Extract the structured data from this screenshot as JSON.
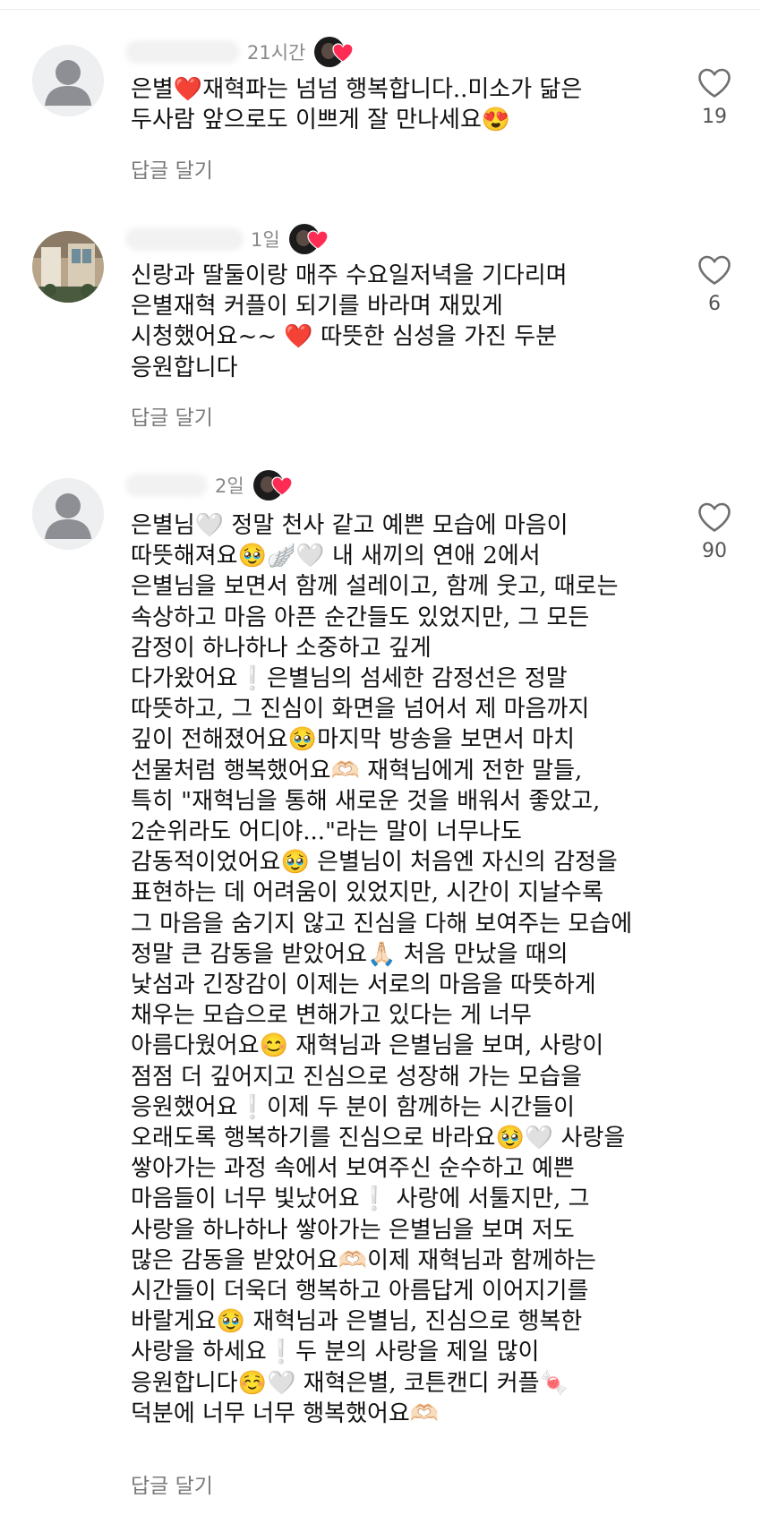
{
  "comments": [
    {
      "time": "21시간",
      "text": "은별❤️재혁파는 넘넘 행복합니다..미소가 닮은\n두사람 앞으로도 이쁘게 잘 만나세요😍",
      "reply_label": "답글 달기",
      "likes": "19",
      "avatar": "default-avatar"
    },
    {
      "time": "1일",
      "text": "신랑과 딸둘이랑 매주 수요일저녁을 기다리며\n은별재혁 커플이 되기를 바라며 재밌게\n시청했어요~~ ❤️ 따뜻한 심성을 가진 두분\n응원합니다",
      "reply_label": "답글 달기",
      "likes": "6",
      "avatar": "photo-avatar"
    },
    {
      "time": "2일",
      "text": "은별님🤍 정말 천사 같고 예쁜 모습에 마음이\n따뜻해져요🥹🪽🤍 내 새끼의 연애 2에서\n은별님을 보면서 함께 설레이고, 함께 웃고, 때로는\n속상하고 마음 아픈 순간들도 있었지만, 그 모든\n감정이 하나하나 소중하고 깊게\n다가왔어요❕은별님의 섬세한 감정선은 정말\n따뜻하고, 그 진심이 화면을 넘어서 제 마음까지\n깊이 전해졌어요🥹마지막 방송을 보면서 마치\n선물처럼 행복했어요🫶🏻 재혁님에게 전한 말들,\n특히 \"재혁님을 통해 새로운 것을 배워서 좋았고,\n2순위라도 어디야...\"라는 말이 너무나도\n감동적이었어요🥹 은별님이 처음엔 자신의 감정을\n표현하는 데 어려움이 있었지만, 시간이 지날수록\n그 마음을 숨기지 않고 진심을 다해 보여주는 모습에\n정말 큰 감동을 받았어요🙏🏻 처음 만났을 때의\n낯섬과 긴장감이 이제는 서로의 마음을 따뜻하게\n채우는 모습으로 변해가고 있다는 게 너무\n아름다웠어요😊 재혁님과 은별님을 보며, 사랑이\n점점 더 깊어지고 진심으로 성장해 가는 모습을\n응원했어요❕이제 두 분이 함께하는 시간들이\n오래도록 행복하기를 진심으로 바라요🥹🤍 사랑을\n쌓아가는 과정 속에서 보여주신 순수하고 예쁜\n마음들이 너무 빛났어요❕ 사랑에 서툴지만, 그\n사랑을 하나하나 쌓아가는 은별님을 보며 저도\n많은 감동을 받았어요🫶🏻이제 재혁님과 함께하는\n시간들이 더욱더 행복하고 아름답게 이어지기를\n바랄게요🥹 재혁님과 은별님, 진심으로 행복한\n사랑을 하세요❕두 분의 사랑을 제일 많이\n응원합니다☺️🤍 재혁은별, 코튼캔디 커플🍬\n덕분에 너무 너무 행복했어요🫶🏻",
      "reply_label": "답글 달기",
      "likes": "90",
      "avatar": "default-avatar"
    }
  ],
  "icons": {
    "like": "heart-outline-icon",
    "creator_heart": "creator-heart-icon"
  },
  "colors": {
    "heart_red": "#fe2c55",
    "muted_text": "#8a8a8a",
    "body_text": "#111111"
  }
}
